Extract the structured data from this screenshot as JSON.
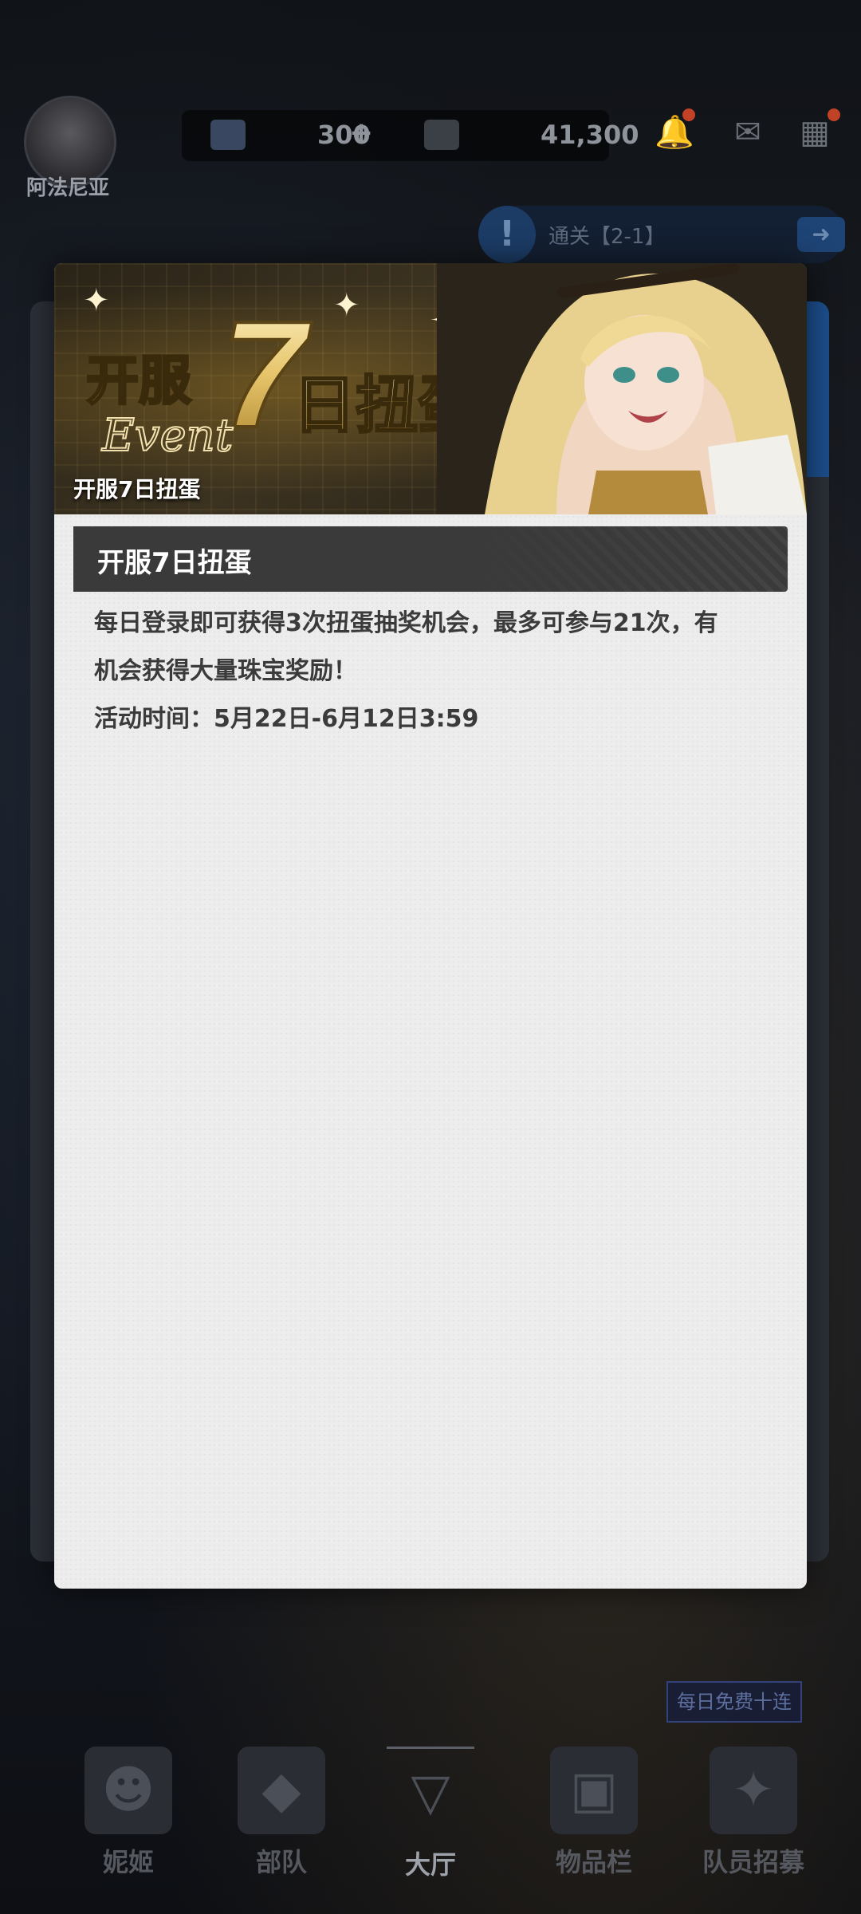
{
  "header": {
    "player_name": "阿法尼亚",
    "currency_1": "300",
    "currency_1_add": "+",
    "currency_2": "41,300",
    "icons": [
      "bell-icon",
      "mail-icon",
      "menu-grid-icon"
    ]
  },
  "stage": {
    "label": "通关【2-1】",
    "alert_icon": "!",
    "go_icon": "➜"
  },
  "dialog": {
    "banner_caption": "开服7日扭蛋",
    "banner_logo_text": "开服7日扭蛋",
    "banner_logo_script": "Event",
    "title": "开服7日扭蛋",
    "description_line1": "每日登录即可获得3次扭蛋抽奖机会，最多可参与21次，有",
    "description_line2": "机会获得大量珠宝奖励！",
    "description_line3": "活动时间：5月22日-6月12日3:59"
  },
  "bottom_nav": {
    "items": [
      {
        "label": "妮姬",
        "icon": "nikke-icon"
      },
      {
        "label": "部队",
        "icon": "squad-icon"
      },
      {
        "label": "大厅",
        "icon": "lobby-icon",
        "active": true
      },
      {
        "label": "物品栏",
        "icon": "inventory-icon"
      },
      {
        "label": "队员招募",
        "icon": "recruit-icon"
      }
    ],
    "recruit_badge": "每日免费十连"
  }
}
